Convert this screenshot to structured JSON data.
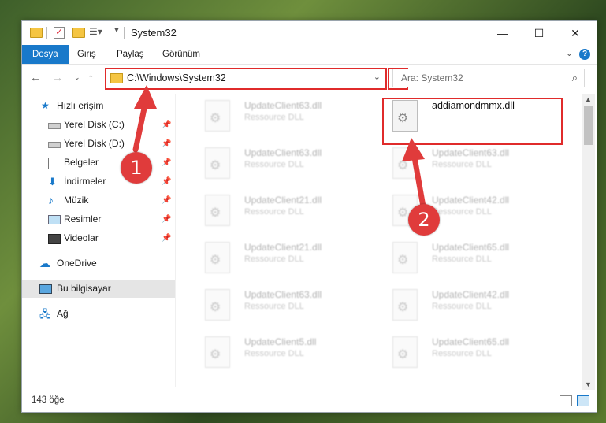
{
  "window": {
    "title": "System32",
    "controls": {
      "minimize": "—",
      "maximize": "☐",
      "close": "✕"
    }
  },
  "ribbon": {
    "tabs": [
      "Dosya",
      "Giriş",
      "Paylaş",
      "Görünüm"
    ],
    "help_label": "?"
  },
  "navigation": {
    "address": "C:\\Windows\\System32",
    "search_placeholder": "Ara: System32"
  },
  "sidebar": {
    "items": [
      {
        "label": "Hızlı erişim",
        "icon": "star-icon",
        "pinned": false
      },
      {
        "label": "Yerel Disk (C:)",
        "icon": "drive-icon",
        "pinned": true
      },
      {
        "label": "Yerel Disk (D:)",
        "icon": "drive-icon",
        "pinned": true
      },
      {
        "label": "Belgeler",
        "icon": "documents-icon",
        "pinned": true
      },
      {
        "label": "İndirmeler",
        "icon": "download-icon",
        "pinned": true
      },
      {
        "label": "Müzik",
        "icon": "music-icon",
        "pinned": true
      },
      {
        "label": "Resimler",
        "icon": "pictures-icon",
        "pinned": true
      },
      {
        "label": "Videolar",
        "icon": "video-icon",
        "pinned": true
      },
      {
        "label": "OneDrive",
        "icon": "cloud-icon",
        "pinned": false
      },
      {
        "label": "Bu bilgisayar",
        "icon": "computer-icon",
        "pinned": false,
        "selected": true
      },
      {
        "label": "Ağ",
        "icon": "network-icon",
        "pinned": false
      }
    ]
  },
  "files": [
    {
      "name": "UpdateClient63.dll",
      "type": "Ressource DLL"
    },
    {
      "name": "addiamondmmx.dll",
      "type": ""
    },
    {
      "name": "UpdateClient63.dll",
      "type": "Ressource DLL"
    },
    {
      "name": "UpdateClient63.dll",
      "type": "Ressource DLL"
    },
    {
      "name": "UpdateClient21.dll",
      "type": "Ressource DLL"
    },
    {
      "name": "UpdateClient42.dll",
      "type": "Ressource DLL"
    },
    {
      "name": "UpdateClient21.dll",
      "type": "Ressource DLL"
    },
    {
      "name": "UpdateClient65.dll",
      "type": "Ressource DLL"
    },
    {
      "name": "UpdateClient63.dll",
      "type": "Ressource DLL"
    },
    {
      "name": "UpdateClient42.dll",
      "type": "Ressource DLL"
    },
    {
      "name": "UpdateClient5.dll",
      "type": "Ressource DLL"
    },
    {
      "name": "UpdateClient65.dll",
      "type": "Ressource DLL"
    }
  ],
  "status": {
    "item_count": "143 öğe"
  },
  "annotations": {
    "step1": "1",
    "step2": "2",
    "color": "#e03b3b"
  }
}
